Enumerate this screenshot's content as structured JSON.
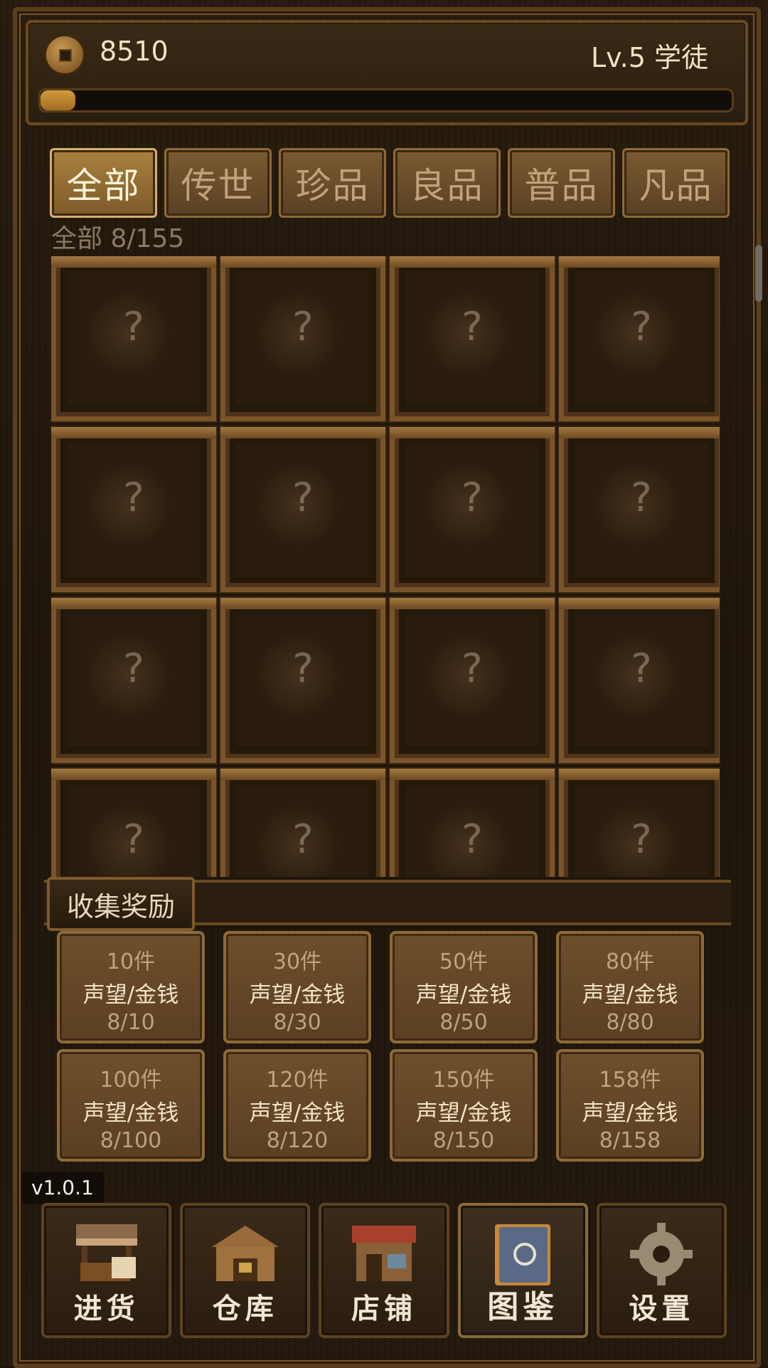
{
  "header": {
    "coin_value": "8510",
    "level_text": "Lv.5 学徒",
    "xp_progress": 0.05
  },
  "tabs": [
    {
      "label": "全部",
      "active": true
    },
    {
      "label": "传世",
      "active": false
    },
    {
      "label": "珍品",
      "active": false
    },
    {
      "label": "良品",
      "active": false
    },
    {
      "label": "普品",
      "active": false
    },
    {
      "label": "凡品",
      "active": false
    }
  ],
  "collection_count": "全部 8/155",
  "grid_items": [
    {
      "art": "coin",
      "mark": "?"
    },
    {
      "art": "porcelain-jar",
      "mark": "?"
    },
    {
      "art": "jade-pendant",
      "mark": "?"
    },
    {
      "art": "red-box",
      "mark": "?"
    },
    {
      "art": "white-jade",
      "mark": "?"
    },
    {
      "art": "blue-plate",
      "mark": "?"
    },
    {
      "art": "bowl",
      "mark": "?"
    },
    {
      "art": "green-pendant",
      "mark": "?"
    },
    {
      "art": "painting",
      "mark": "?"
    },
    {
      "art": "bowl",
      "mark": "?"
    },
    {
      "art": "red-seal",
      "mark": "?"
    },
    {
      "art": "vase",
      "mark": "?"
    },
    {
      "art": "plate",
      "mark": "?"
    },
    {
      "art": "book",
      "mark": "?"
    },
    {
      "art": "cup",
      "mark": "?"
    },
    {
      "art": "mirror",
      "mark": "?"
    }
  ],
  "rewards": {
    "title": "收集奖励",
    "items": [
      {
        "target": "10件",
        "reward": "声望/金钱",
        "progress": "8/10"
      },
      {
        "target": "30件",
        "reward": "声望/金钱",
        "progress": "8/30"
      },
      {
        "target": "50件",
        "reward": "声望/金钱",
        "progress": "8/50"
      },
      {
        "target": "80件",
        "reward": "声望/金钱",
        "progress": "8/80"
      },
      {
        "target": "100件",
        "reward": "声望/金钱",
        "progress": "8/100"
      },
      {
        "target": "120件",
        "reward": "声望/金钱",
        "progress": "8/120"
      },
      {
        "target": "150件",
        "reward": "声望/金钱",
        "progress": "8/150"
      },
      {
        "target": "158件",
        "reward": "声望/金钱",
        "progress": "8/158"
      }
    ]
  },
  "version": "v1.0.1",
  "nav": [
    {
      "label": "进货",
      "icon": "market-stall-icon",
      "active": false
    },
    {
      "label": "仓库",
      "icon": "warehouse-icon",
      "active": false
    },
    {
      "label": "店铺",
      "icon": "shop-icon",
      "active": false
    },
    {
      "label": "图鉴",
      "icon": "book-icon",
      "active": true
    },
    {
      "label": "设置",
      "icon": "gear-icon",
      "active": false
    }
  ]
}
